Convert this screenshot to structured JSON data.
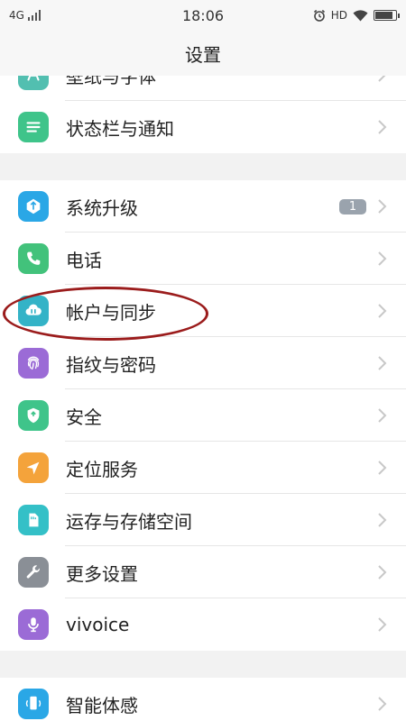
{
  "status_bar": {
    "network": "4G",
    "time": "18:06",
    "hd": "HD",
    "battery_level": 0.95
  },
  "header": {
    "title": "设置"
  },
  "groups": [
    [
      {
        "label": "壁纸与字体",
        "icon": "font-icon",
        "color": "#52bfb0"
      },
      {
        "label": "状态栏与通知",
        "icon": "menu-icon",
        "color": "#3fc48a"
      }
    ],
    [
      {
        "label": "系统升级",
        "icon": "upgrade-icon",
        "color": "#2aa7e6",
        "badge": "1"
      },
      {
        "label": "电话",
        "icon": "phone-icon",
        "color": "#42c27b"
      },
      {
        "label": "帐户与同步",
        "icon": "cloud-sync-icon",
        "color": "#34b3c7"
      },
      {
        "label": "指纹与密码",
        "icon": "fingerprint-icon",
        "color": "#9b6bd6"
      },
      {
        "label": "安全",
        "icon": "shield-icon",
        "color": "#3fc48a"
      },
      {
        "label": "定位服务",
        "icon": "location-icon",
        "color": "#f4a33b"
      },
      {
        "label": "运存与存储空间",
        "icon": "storage-icon",
        "color": "#34c0c7"
      },
      {
        "label": "更多设置",
        "icon": "wrench-icon",
        "color": "#8a8f96"
      },
      {
        "label": "vivoice",
        "icon": "microphone-icon",
        "color": "#9b6bd6"
      }
    ],
    [
      {
        "label": "智能体感",
        "icon": "motion-icon",
        "color": "#2aa7e6"
      }
    ]
  ]
}
